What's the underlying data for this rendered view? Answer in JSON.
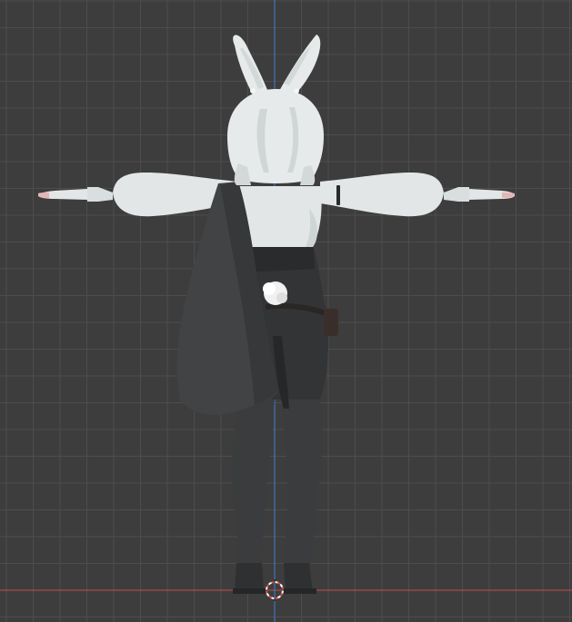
{
  "viewport": {
    "background_color": "#3d3d3d",
    "grid_color": "#4d4d4d",
    "axis_x_color": "#c84b4b",
    "axis_z_color": "#3f7fd6",
    "model_colors": {
      "skin": "#e2e6e6",
      "skin_shade": "#cfd4d4",
      "hair": "#e6eaea",
      "suit": "#2e2f30",
      "suit_shade": "#252627",
      "legs": "#3b3c3d",
      "cape": "#414344",
      "cape_shade": "#36383a",
      "belt": "#2a2625",
      "pouch": "#3a2e2b",
      "tail": "#f1f1f1",
      "fingertip": "#e4b6b6"
    },
    "icons": {
      "origin_cursor": "3d-cursor-icon"
    }
  }
}
